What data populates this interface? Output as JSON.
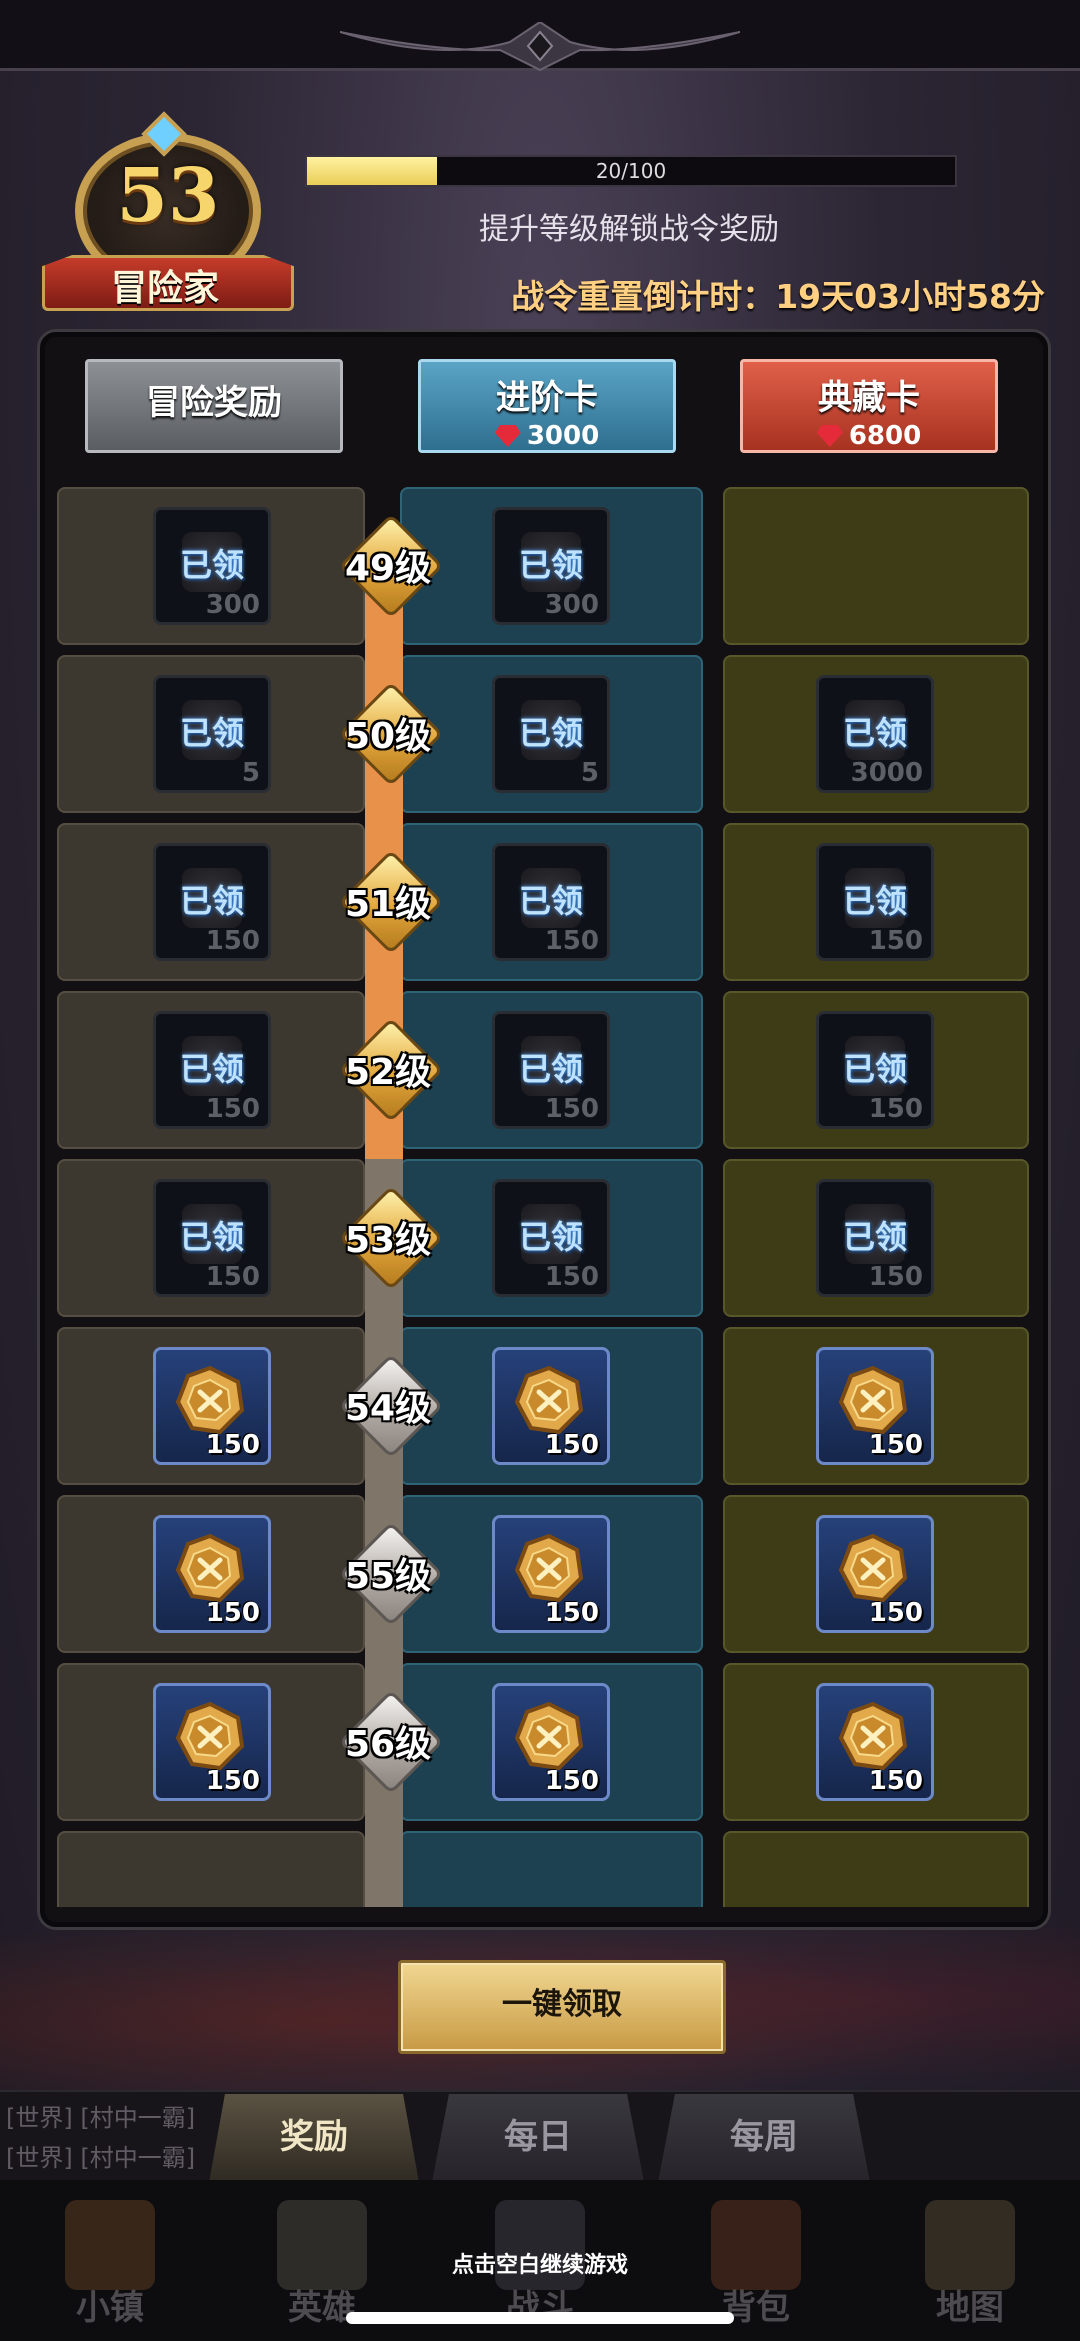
{
  "badge": {
    "level": "53",
    "title": "冒险家"
  },
  "progress": {
    "text": "20/100",
    "current": 20,
    "max": 100
  },
  "hint": "提升等级解锁战令奖励",
  "countdown": "战令重置倒计时：19天03小时58分",
  "headers": {
    "adventure": {
      "label": "冒险奖励"
    },
    "advanced": {
      "label": "进阶卡",
      "price": "3000"
    },
    "collector": {
      "label": "典藏卡",
      "price": "6800"
    }
  },
  "claimed_stamp": "已领",
  "rows": [
    {
      "level": "49级",
      "reached": true,
      "a": {
        "state": "claimed",
        "count": "300"
      },
      "b": {
        "state": "claimed",
        "count": "300"
      },
      "c": null
    },
    {
      "level": "50级",
      "reached": true,
      "a": {
        "state": "claimed",
        "count": "5"
      },
      "b": {
        "state": "claimed",
        "count": "5"
      },
      "c": {
        "state": "claimed",
        "count": "3000"
      }
    },
    {
      "level": "51级",
      "reached": true,
      "a": {
        "state": "claimed",
        "count": "150"
      },
      "b": {
        "state": "claimed",
        "count": "150"
      },
      "c": {
        "state": "claimed",
        "count": "150"
      }
    },
    {
      "level": "52级",
      "reached": true,
      "a": {
        "state": "claimed",
        "count": "150"
      },
      "b": {
        "state": "claimed",
        "count": "150"
      },
      "c": {
        "state": "claimed",
        "count": "150"
      }
    },
    {
      "level": "53级",
      "reached": true,
      "a": {
        "state": "claimed",
        "count": "150"
      },
      "b": {
        "state": "claimed",
        "count": "150"
      },
      "c": {
        "state": "claimed",
        "count": "150"
      }
    },
    {
      "level": "54级",
      "reached": false,
      "a": {
        "state": "open",
        "count": "150"
      },
      "b": {
        "state": "open",
        "count": "150"
      },
      "c": {
        "state": "open",
        "count": "150"
      }
    },
    {
      "level": "55级",
      "reached": false,
      "a": {
        "state": "open",
        "count": "150"
      },
      "b": {
        "state": "open",
        "count": "150"
      },
      "c": {
        "state": "open",
        "count": "150"
      }
    },
    {
      "level": "56级",
      "reached": false,
      "a": {
        "state": "open",
        "count": "150"
      },
      "b": {
        "state": "open",
        "count": "150"
      },
      "c": {
        "state": "open",
        "count": "150"
      }
    }
  ],
  "claim_all": "一键领取",
  "chat_lines": [
    "[世界] [村中一霸]",
    "[世界] [村中一霸]"
  ],
  "tabs": [
    {
      "label": "奖励",
      "active": true
    },
    {
      "label": "每日",
      "active": false
    },
    {
      "label": "每周",
      "active": false
    }
  ],
  "nav": [
    "小镇",
    "英雄",
    "战斗",
    "背包",
    "地图"
  ],
  "continue_hint": "点击空白继续游戏",
  "colors": {
    "accent_gold": "#e9cd58",
    "countdown": "#ffcf82",
    "track_done": "#e8914a",
    "track_todo": "#807569"
  }
}
